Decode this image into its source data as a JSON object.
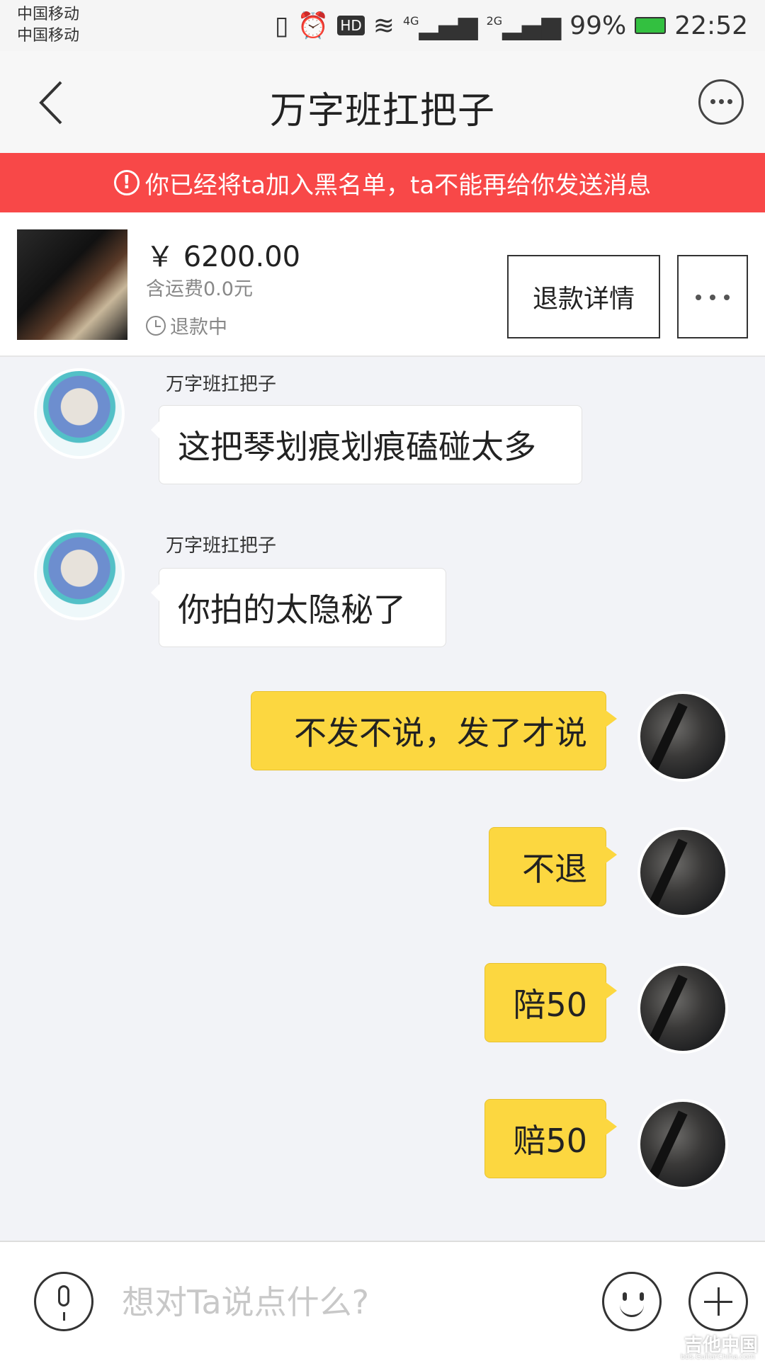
{
  "status_bar": {
    "carrier1": "中国移动",
    "carrier2": "中国移动",
    "battery": "99%",
    "time": "22:52",
    "net1": "4G",
    "net2": "2G",
    "hd": "HD"
  },
  "header": {
    "title": "万字班扛把子"
  },
  "banner": {
    "text": "你已经将ta加入黑名单，ta不能再给你发送消息"
  },
  "product": {
    "price": "￥ 6200.00",
    "shipping": "含运费0.0元",
    "status": "退款中",
    "refund_details_label": "退款详情"
  },
  "messages": [
    {
      "side": "left",
      "sender": "万字班扛把子",
      "text": "这把琴划痕划痕磕碰太多"
    },
    {
      "side": "left",
      "sender": "万字班扛把子",
      "text": "你拍的太隐秘了"
    },
    {
      "side": "right",
      "text": "不发不说，发了才说"
    },
    {
      "side": "right",
      "text": "不退"
    },
    {
      "side": "right",
      "text": "陪50"
    },
    {
      "side": "right",
      "text": "赔50"
    }
  ],
  "input": {
    "placeholder": "想对Ta说点什么?"
  },
  "watermark": {
    "text": "吉他中国",
    "sub": "bbs.GuitarChina.com"
  },
  "colors": {
    "banner_bg": "#f84848",
    "my_bubble": "#fcd740",
    "chat_bg": "#f2f3f7"
  }
}
